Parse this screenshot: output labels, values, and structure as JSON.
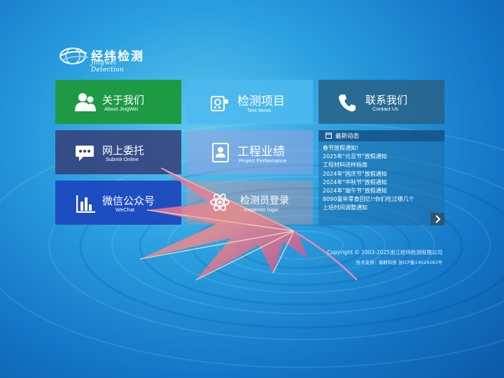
{
  "logo": {
    "name": "经纬检测",
    "subtitle": "Jingwei Detection"
  },
  "tiles": {
    "about": {
      "title": "关于我们",
      "subtitle": "About JingWei"
    },
    "test": {
      "title": "检测项目",
      "subtitle": "Test Items"
    },
    "contact": {
      "title": "联系我们",
      "subtitle": "Contact Us"
    },
    "online": {
      "title": "网上委托",
      "subtitle": "Submit Online"
    },
    "project": {
      "title": "工程业绩",
      "subtitle": "Project Performance"
    },
    "wechat": {
      "title": "微信公众号",
      "subtitle": "WeChat"
    },
    "inspector": {
      "title": "检测员登录",
      "subtitle": "Inspector login"
    }
  },
  "news": {
    "title": "最新动态",
    "items": [
      "春节放假通知!",
      "2025年\"元旦节\"放假通知",
      "工程材料送样指南",
      "2024年\"国庆节\"放假通知",
      "2024年\"中秋节\"放假通知",
      "2024年\"端午节\"放假通知",
      "8090童年零食回忆!!你们吃过哪几个",
      "上班时间调整通知"
    ]
  },
  "footer": {
    "copyright": "Copyright © 2003-2025浙江经纬检测有限公司",
    "tech": "技术支持：瑞联科技   浙ICP备14024283号"
  },
  "colors": {
    "about": "#1e9a45",
    "wechat": "#1c44bc",
    "online": "#36407a",
    "contact": "#286082"
  }
}
